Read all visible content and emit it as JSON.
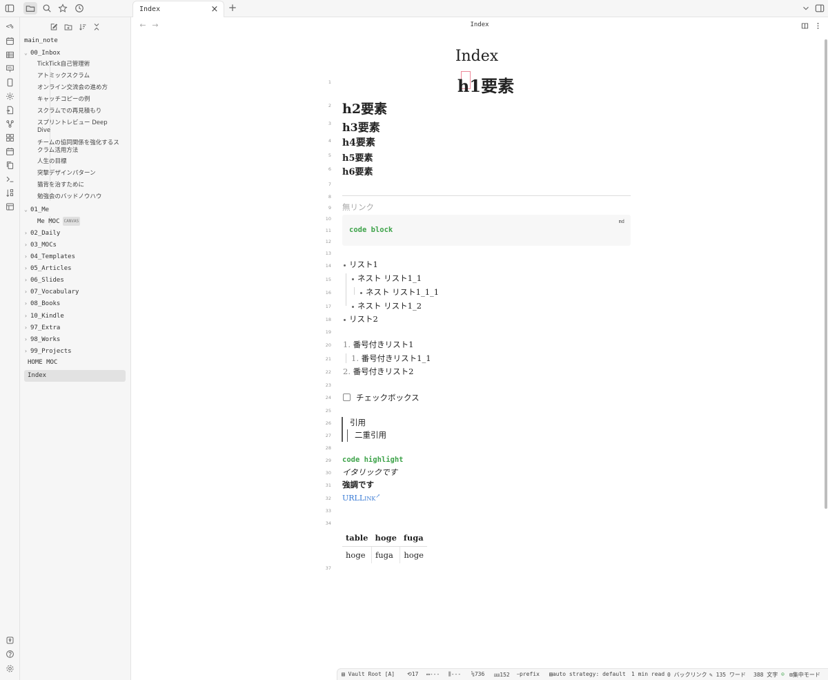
{
  "tab": {
    "title": "Index"
  },
  "ribbon": {
    "switcher_label": "<%"
  },
  "sidebar": {
    "items": [
      {
        "label": "main_note",
        "kind": "file-root"
      },
      {
        "label": "00_Inbox",
        "kind": "folder-open"
      },
      {
        "label": "TickTick自己管理術",
        "kind": "file"
      },
      {
        "label": "アトミックスクラム",
        "kind": "file"
      },
      {
        "label": "オンライン交流会の進め方",
        "kind": "file"
      },
      {
        "label": "キャッチコピーの例",
        "kind": "file"
      },
      {
        "label": "スクラムでの再見積もり",
        "kind": "file"
      },
      {
        "label": "スプリントレビュー Deep Dive",
        "kind": "file"
      },
      {
        "label": "チームの協同関係を強化するスクラム活用方法",
        "kind": "file"
      },
      {
        "label": "人生の目標",
        "kind": "file"
      },
      {
        "label": "突撃デザインパターン",
        "kind": "file"
      },
      {
        "label": "猫背を治すために",
        "kind": "file"
      },
      {
        "label": "勉強会のバッドノウハウ",
        "kind": "file"
      },
      {
        "label": "01_Me",
        "kind": "folder-open"
      },
      {
        "label": "Me MOC",
        "kind": "file",
        "badge": "CANVAS"
      },
      {
        "label": "02_Daily",
        "kind": "folder"
      },
      {
        "label": "03_MOCs",
        "kind": "folder"
      },
      {
        "label": "04_Templates",
        "kind": "folder"
      },
      {
        "label": "05_Articles",
        "kind": "folder"
      },
      {
        "label": "06_Slides",
        "kind": "folder"
      },
      {
        "label": "07_Vocabulary",
        "kind": "folder"
      },
      {
        "label": "08_Books",
        "kind": "folder"
      },
      {
        "label": "10_Kindle",
        "kind": "folder"
      },
      {
        "label": "97_Extra",
        "kind": "folder"
      },
      {
        "label": "98_Works",
        "kind": "folder"
      },
      {
        "label": "99_Projects",
        "kind": "folder"
      },
      {
        "label": "HOME MOC",
        "kind": "file-root"
      },
      {
        "label": "Index",
        "kind": "file-root-active"
      }
    ]
  },
  "view": {
    "title": "Index"
  },
  "doc": {
    "inline_title": "Index",
    "line_numbers": [
      "1",
      "2",
      "3",
      "4",
      "5",
      "6",
      "7",
      "8",
      "9",
      "10",
      "11",
      "12",
      "13",
      "14",
      "15",
      "16",
      "17",
      "18",
      "19",
      "20",
      "21",
      "22",
      "23",
      "24",
      "25",
      "26",
      "27",
      "28",
      "29",
      "30",
      "31",
      "32",
      "33",
      "34",
      "37"
    ],
    "h1": "h1要素",
    "h2": "h2要素",
    "h3": "h3要素",
    "h4": "h4要素",
    "h5": "h5要素",
    "h6": "h6要素",
    "no_link": "無リンク",
    "code_lang": "md",
    "code_block": "code block",
    "list": [
      "リスト1",
      "ネスト リスト1_1",
      "ネスト リスト1_1_1",
      "ネスト リスト1_2",
      "リスト2"
    ],
    "olist": [
      {
        "num": "1.",
        "text": "番号付きリスト1"
      },
      {
        "num": "1.",
        "text": "番号付きリスト1_1"
      },
      {
        "num": "2.",
        "text": "番号付きリスト2"
      }
    ],
    "checkbox": "チェックボックス",
    "quote": "引用",
    "quote_nested": "二重引用",
    "code_highlight": "code highlight",
    "italic": "イタリックです",
    "bold": "強調です",
    "url_link": "URLLink",
    "table": {
      "headers": [
        "table",
        "hoge",
        "fuga"
      ],
      "rows": [
        [
          "hoge",
          "fuga",
          "hoge"
        ]
      ]
    }
  },
  "status": {
    "vault": "Vault Root [A]",
    "s1": "17",
    "s2": "---",
    "s3": "---",
    "s4": "736",
    "s5": "152",
    "prefix": "prefix",
    "strategy": "auto strategy: default",
    "read_time": "1 min read",
    "backlinks": "0 バックリンク",
    "words": "135 ワード",
    "chars": "388 文字",
    "focus": "集中モード"
  }
}
